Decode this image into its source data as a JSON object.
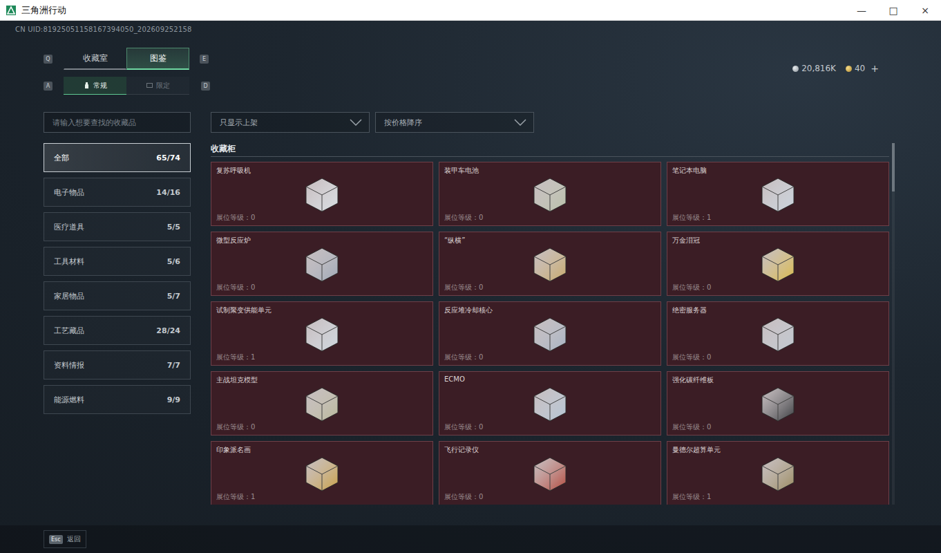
{
  "window": {
    "title": "三角洲行动",
    "controls": [
      "—",
      "□",
      "×"
    ]
  },
  "uid": "CN UID:81925051158167394050_202609252158",
  "currency": [
    {
      "amount": "20,816K",
      "kind": "silver"
    },
    {
      "amount": "40",
      "kind": "gold",
      "action": "+"
    }
  ],
  "tabs": {
    "prev_key": "Q",
    "next_key": "E",
    "items": [
      {
        "label": "收藏室",
        "selected": false
      },
      {
        "label": "图鉴",
        "selected": true
      }
    ]
  },
  "subtabs": {
    "prev_key": "A",
    "next_key": "D",
    "items": [
      {
        "label": "常规",
        "selected": true
      },
      {
        "label": "限定",
        "selected": false
      }
    ]
  },
  "search": {
    "placeholder": "请输入想要查找的收藏品"
  },
  "filters": [
    {
      "label": "只显示上架"
    },
    {
      "label": "按价格降序"
    }
  ],
  "sidebar": {
    "items": [
      {
        "label": "全部",
        "count": "65/74",
        "selected": true
      },
      {
        "label": "电子物品",
        "count": "14/16",
        "selected": false
      },
      {
        "label": "医疗道具",
        "count": "5/5",
        "selected": false
      },
      {
        "label": "工具材料",
        "count": "5/6",
        "selected": false
      },
      {
        "label": "家居物品",
        "count": "5/7",
        "selected": false
      },
      {
        "label": "工艺藏品",
        "count": "28/24",
        "selected": false
      },
      {
        "label": "资料情报",
        "count": "7/7",
        "selected": false
      },
      {
        "label": "能源燃料",
        "count": "9/9",
        "selected": false
      }
    ]
  },
  "section": {
    "title": "收藏柜"
  },
  "items": [
    {
      "name": "复苏呼吸机",
      "level": "展位等级：0"
    },
    {
      "name": "装甲车电池",
      "level": "展位等级：0"
    },
    {
      "name": "笔记本电脑",
      "level": "展位等级：1"
    },
    {
      "name": "微型反应炉",
      "level": "展位等级：0"
    },
    {
      "name": "“纵横”",
      "level": "展位等级：0"
    },
    {
      "name": "万金泪冠",
      "level": "展位等级：0"
    },
    {
      "name": "试制聚变供能单元",
      "level": "展位等级：1"
    },
    {
      "name": "反应堆冷却核心",
      "level": "展位等级：0"
    },
    {
      "name": "绝密服务器",
      "level": "展位等级：0"
    },
    {
      "name": "主战坦克模型",
      "level": "展位等级：0"
    },
    {
      "name": "ECMO",
      "level": "展位等级：0"
    },
    {
      "name": "强化碳纤维板",
      "level": "展位等级：0"
    },
    {
      "name": "印象派名画",
      "level": "展位等级：1"
    },
    {
      "name": "飞行记录仪",
      "level": "展位等级：0"
    },
    {
      "name": "曼德尔超算单元",
      "level": "展位等级：1"
    }
  ],
  "footer": {
    "key": "Esc",
    "label": "返回"
  }
}
